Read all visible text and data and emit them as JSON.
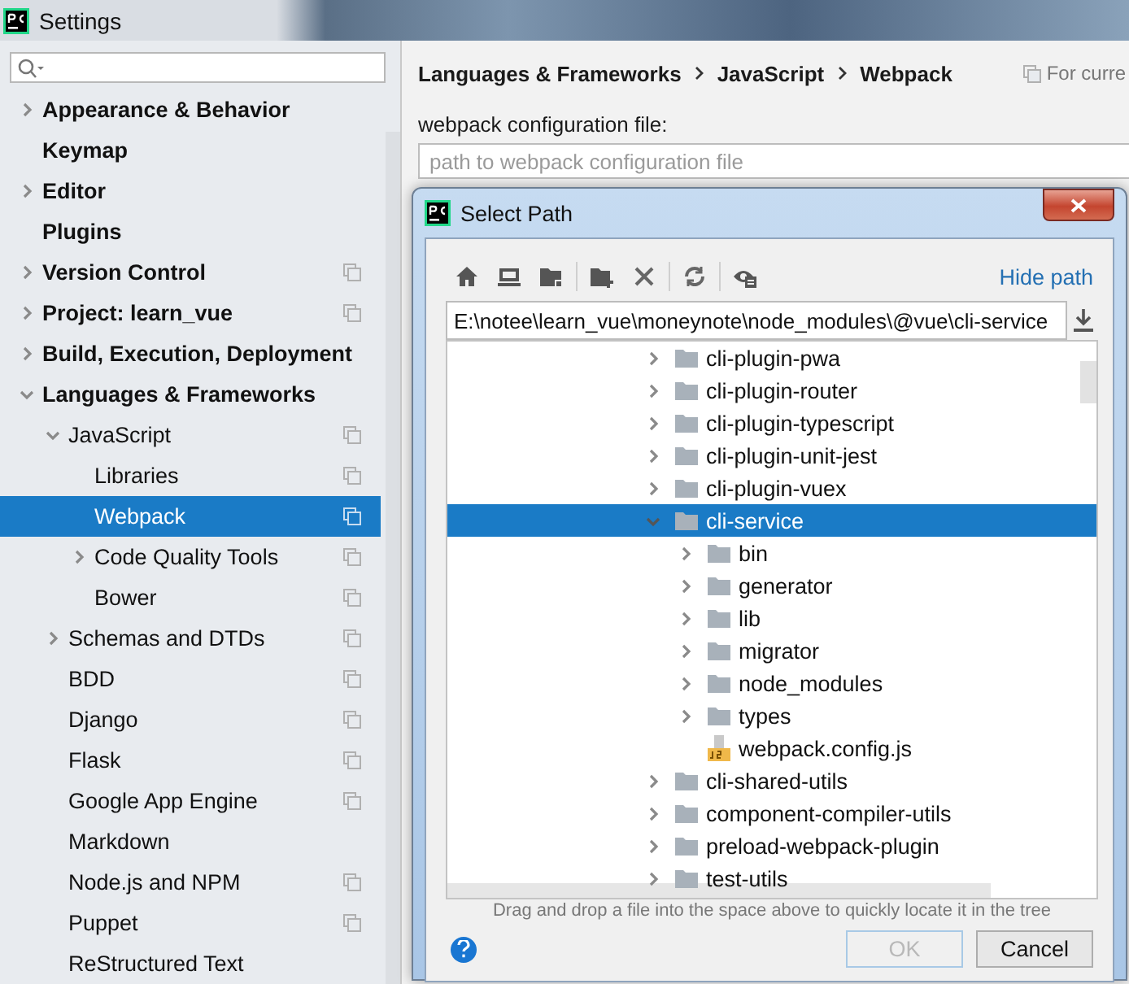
{
  "window": {
    "title": "Settings"
  },
  "sidebar": {
    "items": [
      {
        "label": "Appearance & Behavior",
        "expanded": false,
        "selected": false,
        "project_icon": false
      },
      {
        "label": "Keymap",
        "selected": false,
        "project_icon": false
      },
      {
        "label": "Editor",
        "expanded": false,
        "selected": false,
        "project_icon": false
      },
      {
        "label": "Plugins",
        "selected": false,
        "project_icon": false
      },
      {
        "label": "Version Control",
        "expanded": false,
        "selected": false,
        "project_icon": true
      },
      {
        "label": "Project: learn_vue",
        "expanded": false,
        "selected": false,
        "project_icon": true
      },
      {
        "label": "Build, Execution, Deployment",
        "expanded": false,
        "selected": false,
        "project_icon": false
      },
      {
        "label": "Languages & Frameworks",
        "expanded": true,
        "selected": false,
        "project_icon": false,
        "children": [
          {
            "label": "JavaScript",
            "expanded": true,
            "selected": false,
            "project_icon": true,
            "children": [
              {
                "label": "Libraries",
                "selected": false,
                "project_icon": true
              },
              {
                "label": "Webpack",
                "selected": true,
                "project_icon": true
              },
              {
                "label": "Code Quality Tools",
                "expanded": false,
                "selected": false,
                "project_icon": true
              },
              {
                "label": "Bower",
                "selected": false,
                "project_icon": true
              }
            ]
          },
          {
            "label": "Schemas and DTDs",
            "expanded": false,
            "selected": false,
            "project_icon": true
          },
          {
            "label": "BDD",
            "selected": false,
            "project_icon": true
          },
          {
            "label": "Django",
            "selected": false,
            "project_icon": true
          },
          {
            "label": "Flask",
            "selected": false,
            "project_icon": true
          },
          {
            "label": "Google App Engine",
            "selected": false,
            "project_icon": true
          },
          {
            "label": "Markdown",
            "selected": false,
            "project_icon": false
          },
          {
            "label": "Node.js and NPM",
            "selected": false,
            "project_icon": true
          },
          {
            "label": "Puppet",
            "selected": false,
            "project_icon": true
          },
          {
            "label": "ReStructured Text",
            "selected": false,
            "project_icon": false
          }
        ]
      }
    ]
  },
  "breadcrumb": [
    "Languages & Frameworks",
    "JavaScript",
    "Webpack"
  ],
  "scope_note": "For curre",
  "config_field": {
    "label": "webpack configuration file:",
    "placeholder": "path to webpack configuration file"
  },
  "dialog": {
    "title": "Select Path",
    "hide_path_link": "Hide path",
    "path": "E:\\notee\\learn_vue\\moneynote\\node_modules\\@vue\\cli-service",
    "tree": [
      {
        "label": "cli-plugin-pwa",
        "kind": "folder",
        "expanded": false,
        "selected": false
      },
      {
        "label": "cli-plugin-router",
        "kind": "folder",
        "expanded": false,
        "selected": false
      },
      {
        "label": "cli-plugin-typescript",
        "kind": "folder",
        "expanded": false,
        "selected": false
      },
      {
        "label": "cli-plugin-unit-jest",
        "kind": "folder",
        "expanded": false,
        "selected": false
      },
      {
        "label": "cli-plugin-vuex",
        "kind": "folder",
        "expanded": false,
        "selected": false
      },
      {
        "label": "cli-service",
        "kind": "folder",
        "expanded": true,
        "selected": true,
        "children": [
          {
            "label": "bin",
            "kind": "folder",
            "expanded": false,
            "selected": false
          },
          {
            "label": "generator",
            "kind": "folder",
            "expanded": false,
            "selected": false
          },
          {
            "label": "lib",
            "kind": "folder",
            "expanded": false,
            "selected": false
          },
          {
            "label": "migrator",
            "kind": "folder",
            "expanded": false,
            "selected": false
          },
          {
            "label": "node_modules",
            "kind": "folder",
            "expanded": false,
            "selected": false
          },
          {
            "label": "types",
            "kind": "folder",
            "expanded": false,
            "selected": false
          },
          {
            "label": "webpack.config.js",
            "kind": "js_file",
            "selected": false
          }
        ]
      },
      {
        "label": "cli-shared-utils",
        "kind": "folder",
        "expanded": false,
        "selected": false
      },
      {
        "label": "component-compiler-utils",
        "kind": "folder",
        "expanded": false,
        "selected": false
      },
      {
        "label": "preload-webpack-plugin",
        "kind": "folder",
        "expanded": false,
        "selected": false
      },
      {
        "label": "test-utils",
        "kind": "folder",
        "expanded": false,
        "selected": false
      }
    ],
    "hint": "Drag and drop a file into the space above to quickly locate it in the tree",
    "buttons": [
      {
        "label": "OK",
        "disabled": true
      },
      {
        "label": "Cancel",
        "disabled": false
      }
    ]
  }
}
